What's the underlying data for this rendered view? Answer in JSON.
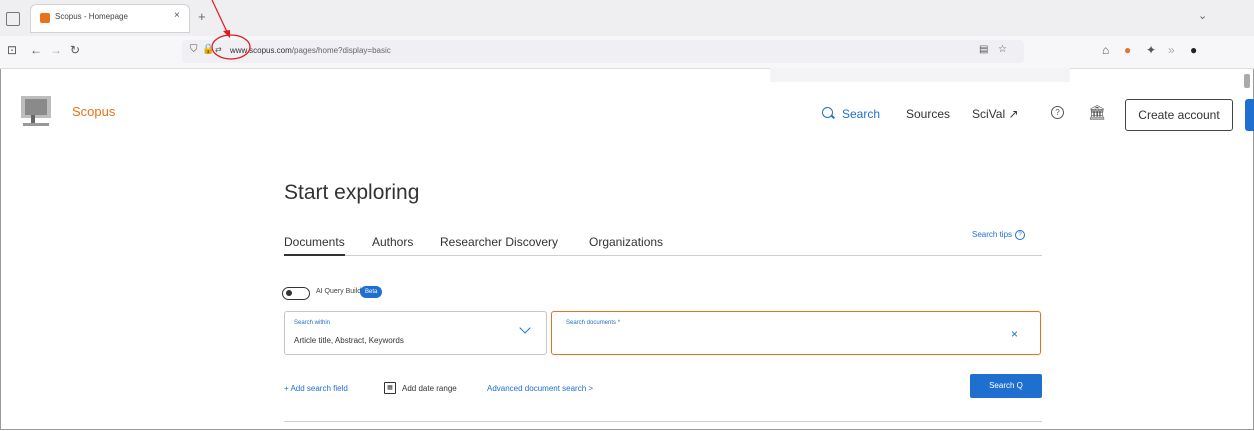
{
  "browser": {
    "tab_title": "Scopus - Homepage",
    "tab_close": "×",
    "new_tab": "+",
    "list_tabs": "⌄",
    "url_host": "www.scopus.com",
    "url_path": "/pages/home?display=basic",
    "reload_icon": "reload-icon"
  },
  "header": {
    "brand": "Scopus",
    "nav": {
      "search": "Search",
      "sources": "Sources",
      "scival": "SciVal ↗"
    },
    "help_glyph": "?",
    "institution_glyph": "🏛",
    "create_account": "Create account"
  },
  "main": {
    "heading": "Start exploring",
    "tabs": [
      {
        "label": "Documents",
        "active": true
      },
      {
        "label": "Authors",
        "active": false
      },
      {
        "label": "Researcher Discovery",
        "active": false
      },
      {
        "label": "Organizations",
        "active": false
      }
    ],
    "search_tips": "Search tips",
    "ai_query_builder": "AI Query Builder",
    "beta_badge": "Beta",
    "search_within_label": "Search within",
    "search_within_value": "Article title, Abstract, Keywords",
    "search_documents_label": "Search documents *",
    "search_documents_value": "",
    "clear_glyph": "×",
    "add_search_field": "+ Add search field",
    "add_date_range": "Add date range",
    "advanced_search": "Advanced document search >",
    "search_button": "Search Q"
  },
  "colors": {
    "accent_orange": "#e9711c",
    "link_blue": "#1f6fd1",
    "annotation_red": "#e21a1a"
  }
}
